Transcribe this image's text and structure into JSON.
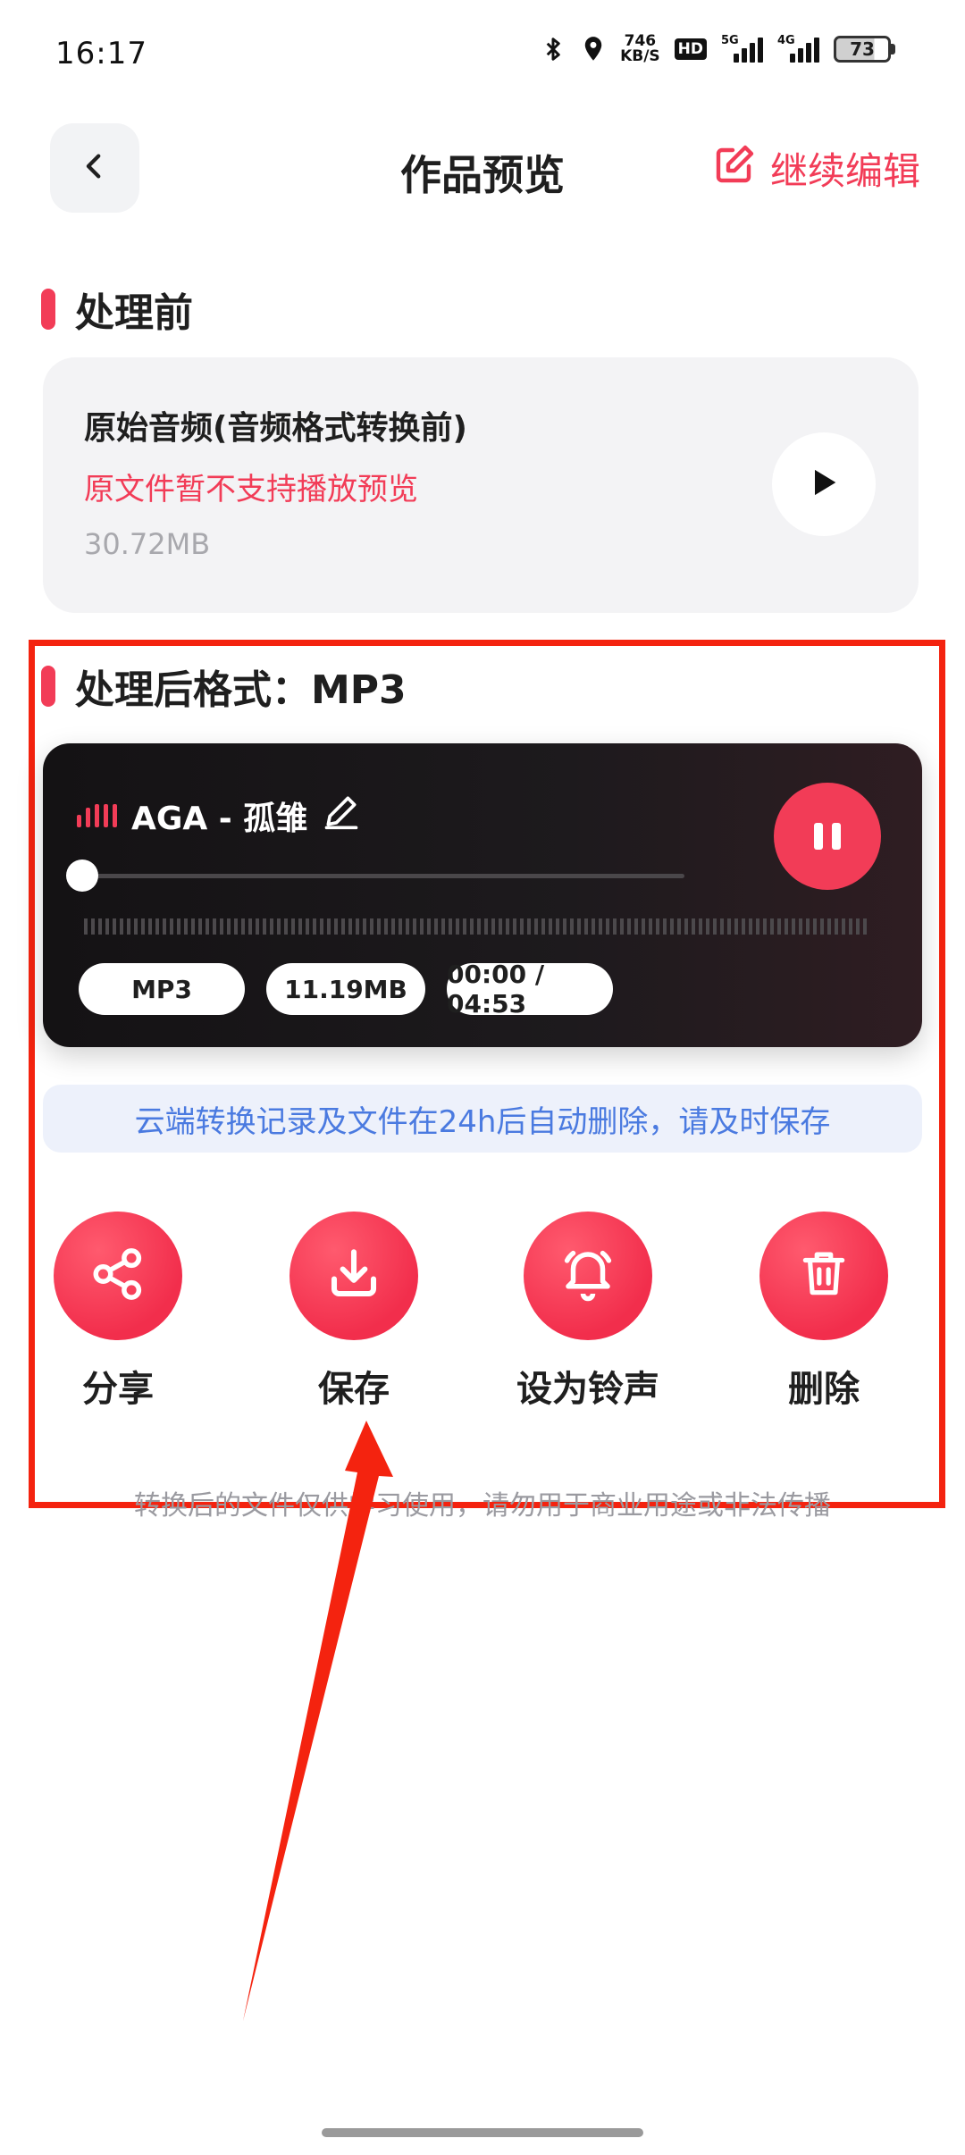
{
  "status_bar": {
    "time": "16:17",
    "net_speed_value": "746",
    "net_speed_unit": "KB/S",
    "hd_label": "HD",
    "sim1_label": "5G",
    "sim2_label": "4G",
    "battery": "73"
  },
  "header": {
    "title": "作品预览",
    "edit_label": "继续编辑"
  },
  "before": {
    "section_title": "处理前",
    "card_title": "原始音频(音频格式转换前)",
    "warning": "原文件暂不支持播放预览",
    "size": "30.72MB"
  },
  "after": {
    "section_title": "处理后格式：MP3",
    "player": {
      "track_name": "AGA - 孤雏",
      "progress_fraction": 0,
      "format": "MP3",
      "size": "11.19MB",
      "time": "00:00 / 04:53"
    },
    "notice": "云端转换记录及文件在24h后自动删除，请及时保存",
    "actions": [
      {
        "label": "分享",
        "icon": "share-icon"
      },
      {
        "label": "保存",
        "icon": "download-icon"
      },
      {
        "label": "设为铃声",
        "icon": "bell-icon"
      },
      {
        "label": "删除",
        "icon": "trash-icon"
      }
    ],
    "disclaimer": "转换后的文件仅供学习使用，请勿用于商业用途或非法传播"
  },
  "colors": {
    "accent": "#f23c57",
    "highlight_border": "#f4230f",
    "notice_text": "#4a7ae0"
  }
}
